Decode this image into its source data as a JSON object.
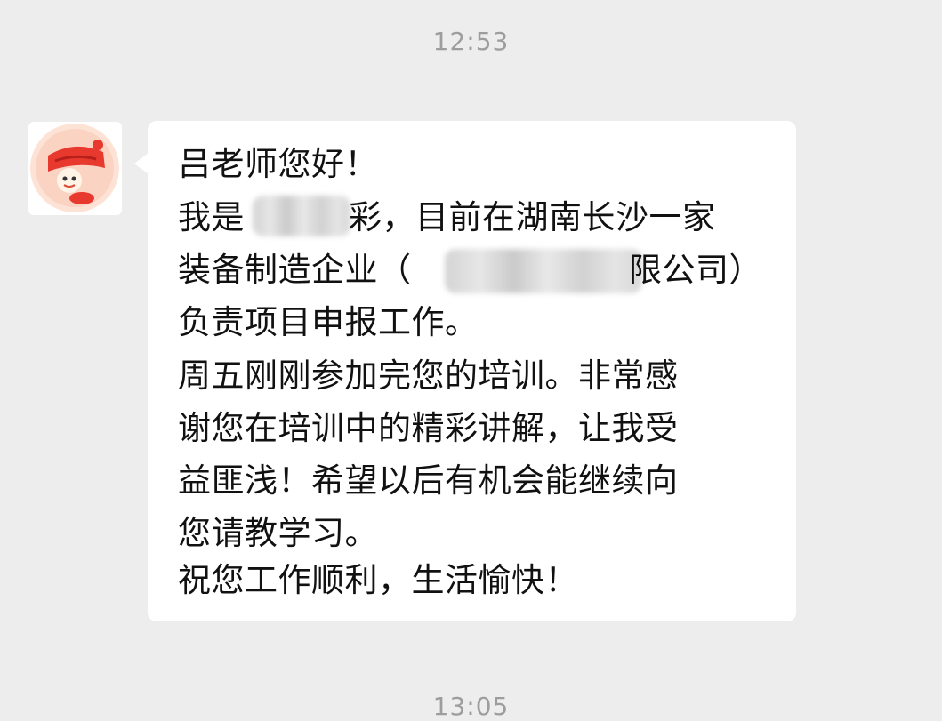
{
  "chat": {
    "time_top": "12:53",
    "time_bottom": "13:05"
  },
  "message": {
    "sender_avatar": "cartoon-avatar-icon",
    "lines": [
      "吕老师您好！",
      "我是",
      "彩，目前在湖南长沙一家",
      "装备制造企业（",
      "限公司）",
      "负责项目申报工作。",
      "周五刚刚参加完您的培训。非常感",
      "谢您在培训中的精彩讲解，让我受",
      "益匪浅！希望以后有机会能继续向",
      "您请教学习。",
      "祝您工作顺利，生活愉快！"
    ]
  },
  "colors": {
    "background": "#ededed",
    "bubble": "#ffffff",
    "text": "#111111",
    "timestamp": "#9d9d9d"
  }
}
